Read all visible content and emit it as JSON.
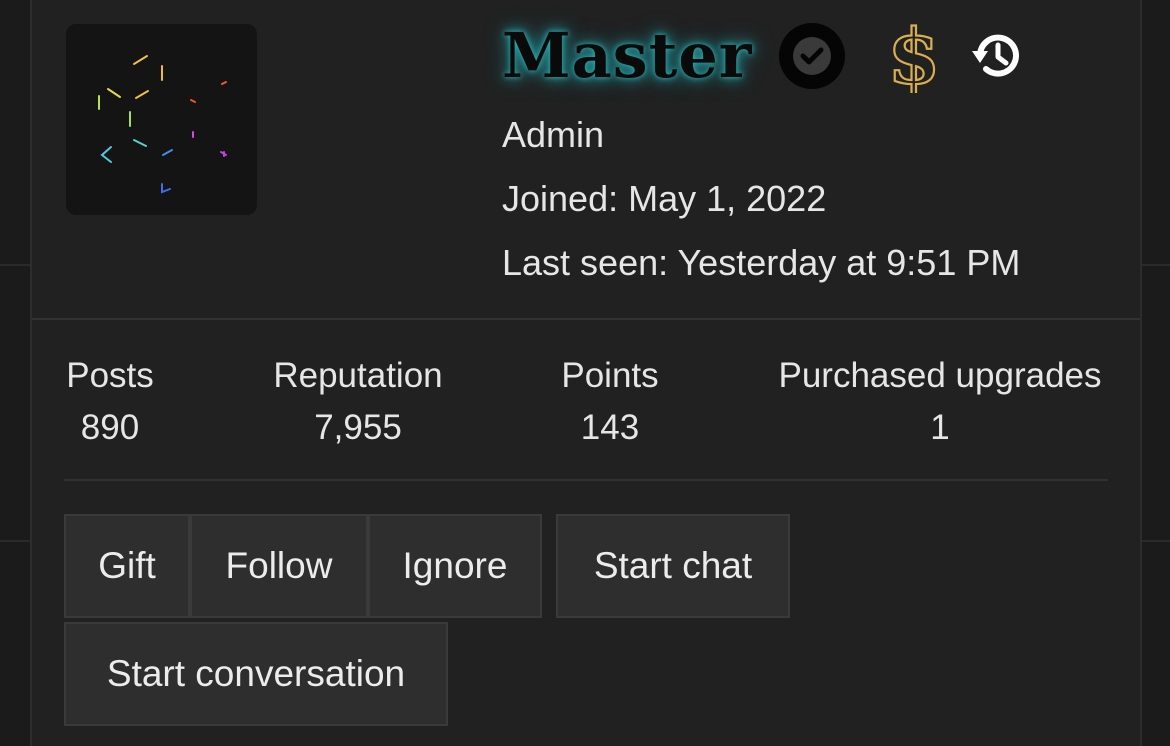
{
  "profile": {
    "user_title": "Master",
    "role": "Admin",
    "joined": "Joined: May 1, 2022",
    "last_seen": "Last seen: Yesterday at 9:51 PM",
    "title_glow_color": "#2fb5b8",
    "icons": [
      "verified-badge-icon",
      "dollar-icon",
      "history-icon"
    ]
  },
  "stats": [
    {
      "label": "Posts",
      "value": "890"
    },
    {
      "label": "Reputation",
      "value": "7,955"
    },
    {
      "label": "Points",
      "value": "143"
    },
    {
      "label": "Purchased upgrades",
      "value": "1"
    }
  ],
  "actions": {
    "gift": "Gift",
    "follow": "Follow",
    "ignore": "Ignore",
    "start_chat": "Start chat",
    "start_conversation": "Start conversation"
  },
  "colors": {
    "background": "#1b1b1b",
    "card": "#212121",
    "button": "#2e2e2e",
    "dollar_gold": "#d9ae4e"
  }
}
